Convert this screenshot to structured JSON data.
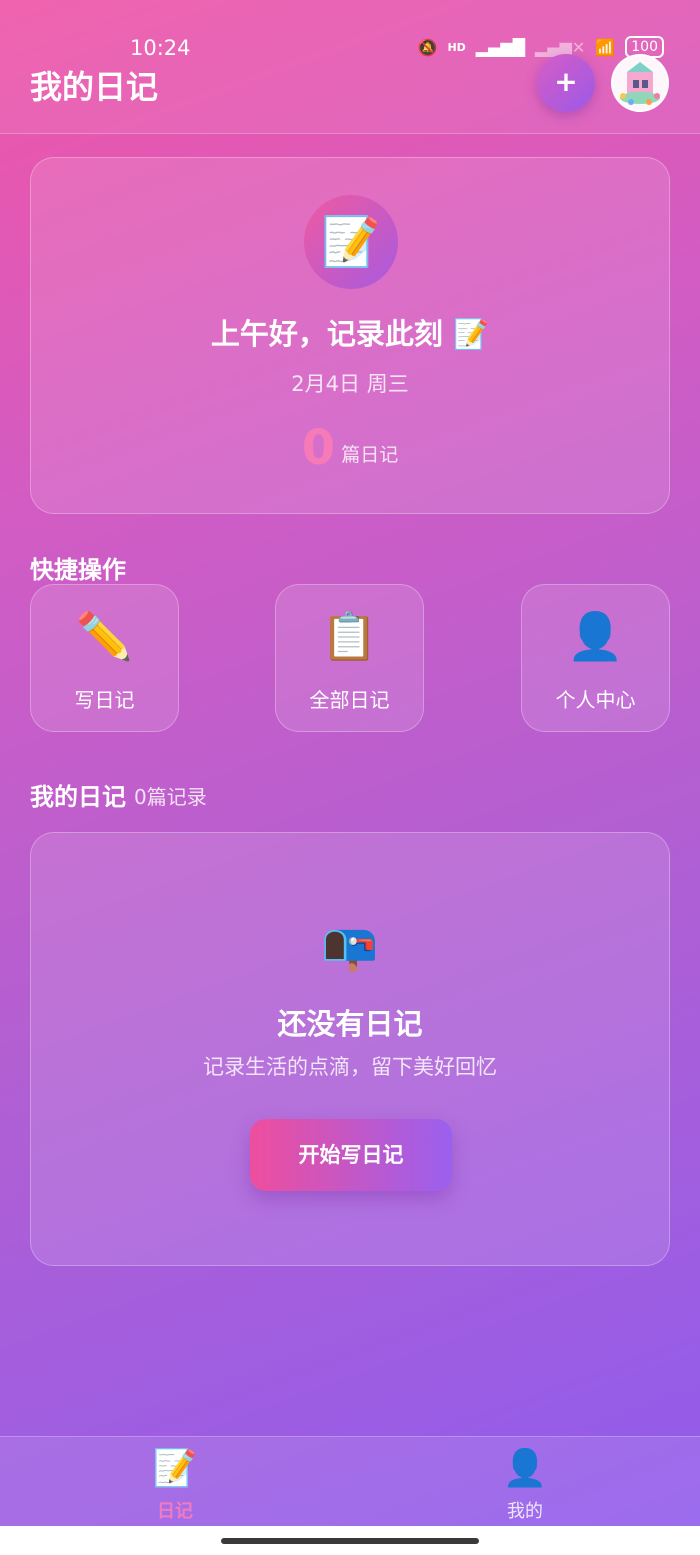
{
  "status_bar": {
    "time": "10:24",
    "battery": "100",
    "hd_label": "HD"
  },
  "header": {
    "title": "我的日记",
    "add_label": "+"
  },
  "hero": {
    "icon": "📝",
    "greeting": "上午好，记录此刻 📝",
    "date": "2月4日 周三",
    "count": "0",
    "count_unit": "篇日记"
  },
  "quick_actions": {
    "title": "快捷操作",
    "items": [
      {
        "icon": "✏️",
        "label": "写日记"
      },
      {
        "icon": "📋",
        "label": "全部日记"
      },
      {
        "icon": "👤",
        "label": "个人中心"
      }
    ]
  },
  "diary_list": {
    "title": "我的日记",
    "count_text": "0篇记录",
    "empty": {
      "icon": "📭",
      "title": "还没有日记",
      "subtitle": "记录生活的点滴，留下美好回忆",
      "button": "开始写日记"
    }
  },
  "tabbar": {
    "tabs": [
      {
        "icon": "📝",
        "label": "日记",
        "active": true
      },
      {
        "icon": "👤",
        "label": "我的",
        "active": false
      }
    ]
  },
  "colors": {
    "accent_pink": "#f57ab7",
    "gradient_start": "#ef56a8",
    "gradient_end": "#8f5ced"
  }
}
